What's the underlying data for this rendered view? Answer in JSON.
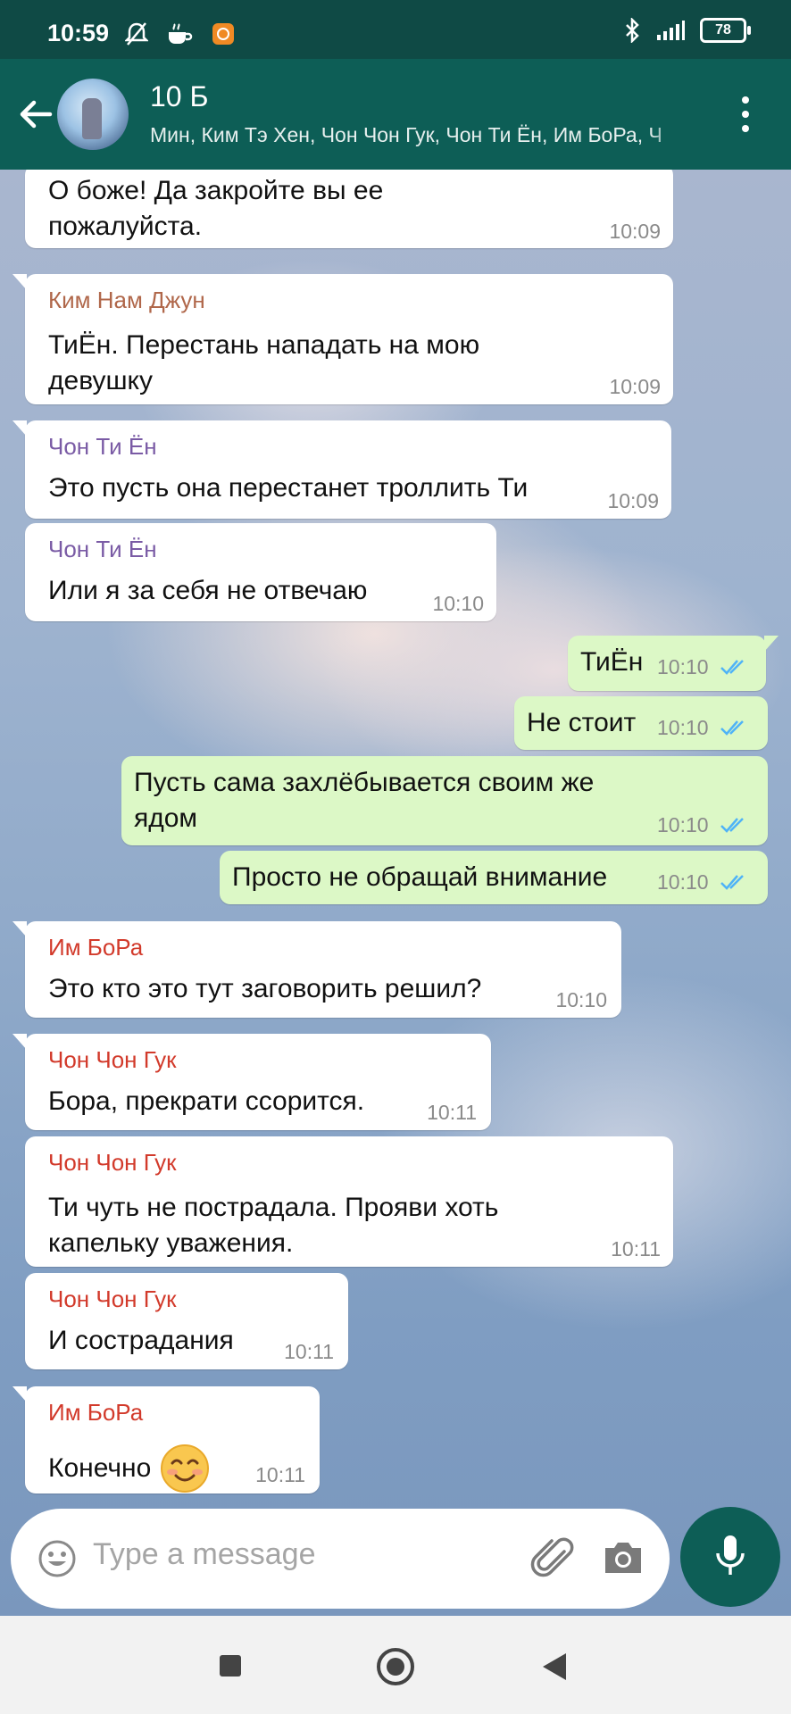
{
  "status_bar": {
    "time": "10:59",
    "battery": "78"
  },
  "header": {
    "title": "10 Б",
    "members": "Мин, Ким Тэ Хен, Чон Чон Гук, Чон Ти Ён, Им БоРа, Ч"
  },
  "messages": [
    {
      "dir": "in",
      "sender": "",
      "text_lines": [
        "О боже! Да закройте вы ее",
        "пожалуйста."
      ],
      "time": "10:09"
    },
    {
      "dir": "in",
      "sender": "Ким Нам Джун",
      "sender_color": "#b0674a",
      "text_lines": [
        "ТиЁн. Перестань нападать на мою",
        "девушку"
      ],
      "time": "10:09"
    },
    {
      "dir": "in",
      "sender": "Чон Ти Ён",
      "sender_color": "#7a5ba5",
      "text_lines": [
        "Это пусть она перестанет троллить Ти"
      ],
      "time": "10:09"
    },
    {
      "dir": "in",
      "sender": "Чон Ти Ён",
      "sender_color": "#7a5ba5",
      "text_lines": [
        "Или я за себя не отвечаю"
      ],
      "time": "10:10"
    },
    {
      "dir": "out",
      "text_lines": [
        "ТиЁн"
      ],
      "time": "10:10"
    },
    {
      "dir": "out",
      "text_lines": [
        "Не стоит"
      ],
      "time": "10:10"
    },
    {
      "dir": "out",
      "text_lines": [
        "Пусть сама захлёбывается своим же",
        "ядом"
      ],
      "time": "10:10"
    },
    {
      "dir": "out",
      "text_lines": [
        "Просто не обращай внимание"
      ],
      "time": "10:10"
    },
    {
      "dir": "in",
      "sender": "Им БоРа",
      "sender_color": "#d23a2b",
      "text_lines": [
        "Это кто это тут заговорить решил?"
      ],
      "time": "10:10"
    },
    {
      "dir": "in",
      "sender": "Чон Чон Гук",
      "sender_color": "#d23a2b",
      "text_lines": [
        "Бора, прекрати ссорится."
      ],
      "time": "10:11"
    },
    {
      "dir": "in",
      "sender": "Чон Чон Гук",
      "sender_color": "#d23a2b",
      "text_lines": [
        "Ти чуть не пострадала. Прояви хоть",
        "капельку уважения."
      ],
      "time": "10:11"
    },
    {
      "dir": "in",
      "sender": "Чон Чон Гук",
      "sender_color": "#d23a2b",
      "text_lines": [
        "И сострадания"
      ],
      "time": "10:11"
    },
    {
      "dir": "in",
      "sender": "Им БоРа",
      "sender_color": "#d23a2b",
      "text_lines": [
        "Конечно"
      ],
      "emoji": "smiling-face",
      "time": "10:11"
    }
  ],
  "composer": {
    "placeholder": "Type a message"
  },
  "colors": {
    "header": "#0d5e56",
    "outgoing": "#dcf8c6",
    "incoming": "#ffffff",
    "read_ticks": "#4fb3f7"
  }
}
